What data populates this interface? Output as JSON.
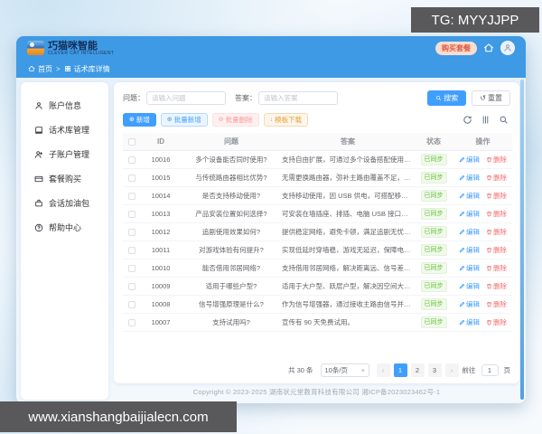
{
  "overlays": {
    "tg_label": "TG: MYYJJPP",
    "site_label": "www.xianshangbaijialecn.com"
  },
  "header": {
    "brand_name": "巧猫咪智能",
    "brand_subtitle": "CLEVER CAT INTELLIGENT",
    "buy_package_label": "购买套餐"
  },
  "breadcrumb": {
    "home": "首页",
    "separator": ">",
    "current": "话术库详情"
  },
  "sidebar": {
    "items": [
      {
        "label": "账户信息"
      },
      {
        "label": "话术库管理"
      },
      {
        "label": "子账户管理"
      },
      {
        "label": "套餐购买"
      },
      {
        "label": "会话加油包"
      },
      {
        "label": "帮助中心"
      }
    ]
  },
  "filters": {
    "question_label": "问题：",
    "question_placeholder": "请输入问题",
    "answer_label": "答案：",
    "answer_placeholder": "请输入答案",
    "search_label": "搜索",
    "reset_label": "重置"
  },
  "toolbar": {
    "add_label": "新增",
    "batch_add_label": "批量新增",
    "batch_delete_label": "批量删除",
    "template_download_label": "模板下载"
  },
  "table": {
    "columns": [
      "ID",
      "问题",
      "答案",
      "状态",
      "操作"
    ],
    "edit_label": "编辑",
    "delete_label": "删除",
    "rows": [
      {
        "id": "10016",
        "question": "多个设备能否同时使用?",
        "answer": "支持自由扩展，可通过多个设备搭配使用，全...",
        "status": "已同步"
      },
      {
        "id": "10015",
        "question": "与传统路由器相比优势?",
        "answer": "无需更换路由器，弥补主路由覆盖不足，即插...",
        "status": "已同步"
      },
      {
        "id": "10014",
        "question": "是否支持移动使用?",
        "answer": "支持移动使用，因 USB 供电，可搭配移动电...",
        "status": "已同步"
      },
      {
        "id": "10013",
        "question": "产品安装位置如何选择?",
        "answer": "可安装在墙插座、排插、电脑 USB 接口等位...",
        "status": "已同步"
      },
      {
        "id": "10012",
        "question": "追剧使用效果如何?",
        "answer": "提供稳定网络，避免卡顿，满足追剧无忧的使...",
        "status": "已同步"
      },
      {
        "id": "10011",
        "question": "对游戏体验有何提升?",
        "answer": "实现低延时穿墙稳，游戏无延迟，保障电竞等...",
        "status": "已同步"
      },
      {
        "id": "10010",
        "question": "能否借用邻居网络?",
        "answer": "支持借用邻居网络，解决距离远、信号差的联...",
        "status": "已同步"
      },
      {
        "id": "10009",
        "question": "适用于哪些户型?",
        "answer": "适用于大户型、跃层户型，解决因空间大、墙...",
        "status": "已同步"
      },
      {
        "id": "10008",
        "question": "信号增强原理是什么?",
        "answer": "作为信号增强器，通过接收主路由信号并放大...",
        "status": "已同步"
      },
      {
        "id": "10007",
        "question": "支持试用吗?",
        "answer": "宣传有 90 天免费试用。",
        "status": "已同步"
      }
    ]
  },
  "pagination": {
    "total_label": "共 30 条",
    "page_size": "10条/页",
    "pages": [
      "1",
      "2",
      "3"
    ],
    "goto_label": "前往",
    "goto_value": "1",
    "goto_suffix": "页"
  },
  "footer": {
    "copyright": "Copyright © 2023-2025 湖南状元堂教育科技有限公司 湘ICP备2023023462号-1"
  },
  "icons": {
    "plus": "⊕",
    "minus": "⊖",
    "download": "↓",
    "reset": "↺",
    "caret_down": "▾",
    "chevron_left": "‹",
    "chevron_right": "›"
  },
  "colors": {
    "accent": "#409eff",
    "header_blue": "#3e9ae4",
    "success": "#67c23a",
    "danger": "#f56c6c",
    "warning": "#e6a23c",
    "overlay_gray": "#59595b"
  }
}
